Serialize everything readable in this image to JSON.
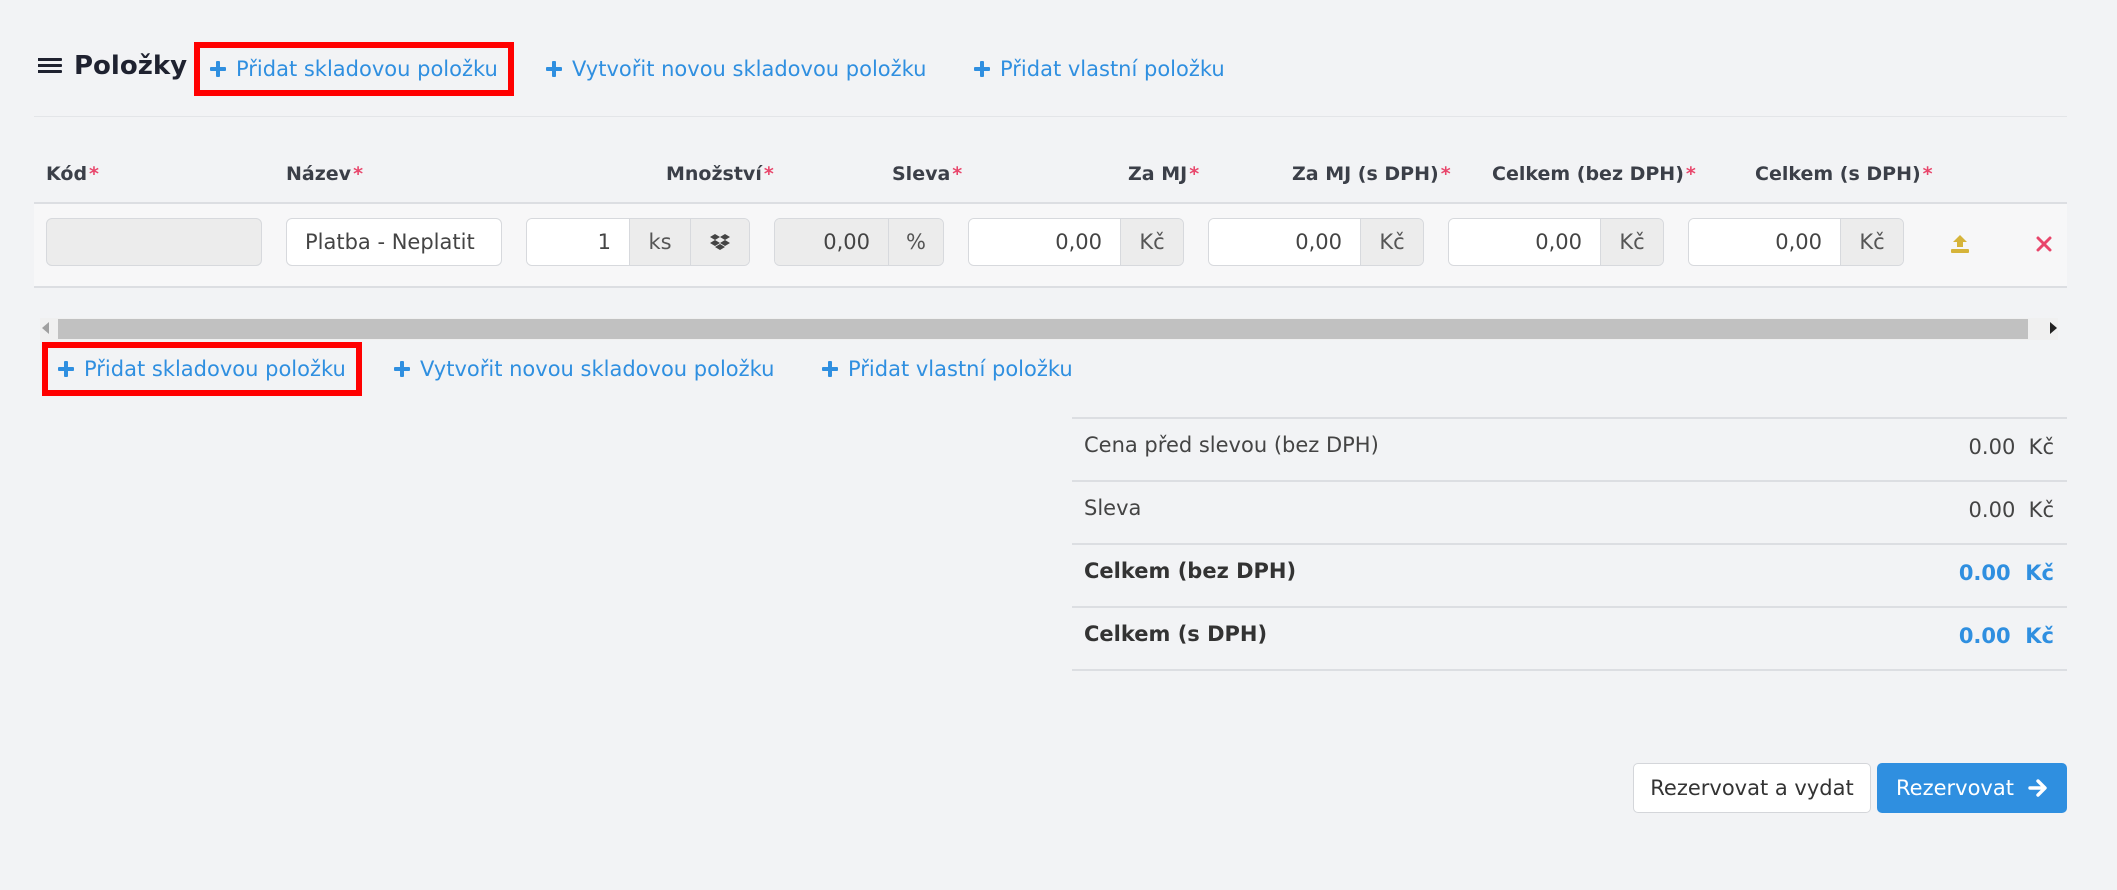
{
  "section": {
    "title": "Položky"
  },
  "actions_top": {
    "add_stock": "Přidat skladovou položku",
    "create_stock": "Vytvořit novou skladovou položku",
    "add_custom": "Přidat vlastní položku"
  },
  "actions_bottom": {
    "add_stock": "Přidat skladovou položku",
    "create_stock": "Vytvořit novou skladovou položku",
    "add_custom": "Přidat vlastní položku"
  },
  "table": {
    "columns": {
      "code": "Kód",
      "name": "Název",
      "quantity": "Množství",
      "discount": "Sleva",
      "unit_price": "Za MJ",
      "unit_price_vat": "Za MJ (s DPH)",
      "total_excl_vat": "Celkem (bez DPH)",
      "total_incl_vat": "Celkem (s DPH)"
    },
    "required_mark": "*",
    "row": {
      "code": "",
      "name": "Platba - Neplatit",
      "quantity": "1",
      "quantity_unit": "ks",
      "discount": "0,00",
      "discount_unit": "%",
      "unit_price": "0,00",
      "unit_price_currency": "Kč",
      "unit_price_vat": "0,00",
      "unit_price_vat_currency": "Kč",
      "total_excl_vat": "0,00",
      "total_excl_vat_currency": "Kč",
      "total_incl_vat": "0,00",
      "total_incl_vat_currency": "Kč"
    }
  },
  "summary": {
    "price_before_discount": {
      "label": "Cena před slevou (bez DPH)",
      "value": "0.00",
      "currency": "Kč"
    },
    "discount": {
      "label": "Sleva",
      "value": "0.00",
      "currency": "Kč"
    },
    "total_excl_vat": {
      "label": "Celkem (bez DPH)",
      "value": "0.00",
      "currency": "Kč"
    },
    "total_incl_vat": {
      "label": "Celkem (s DPH)",
      "value": "0.00",
      "currency": "Kč"
    }
  },
  "buttons": {
    "reserve_and_issue": "Rezervovat a vydat",
    "reserve": "Rezervovat"
  },
  "colors": {
    "accent": "#2f8fe0",
    "required": "#e8466b",
    "highlight": "#ff0000",
    "upload_icon": "#d6b43a",
    "remove_icon": "#e8466b"
  }
}
